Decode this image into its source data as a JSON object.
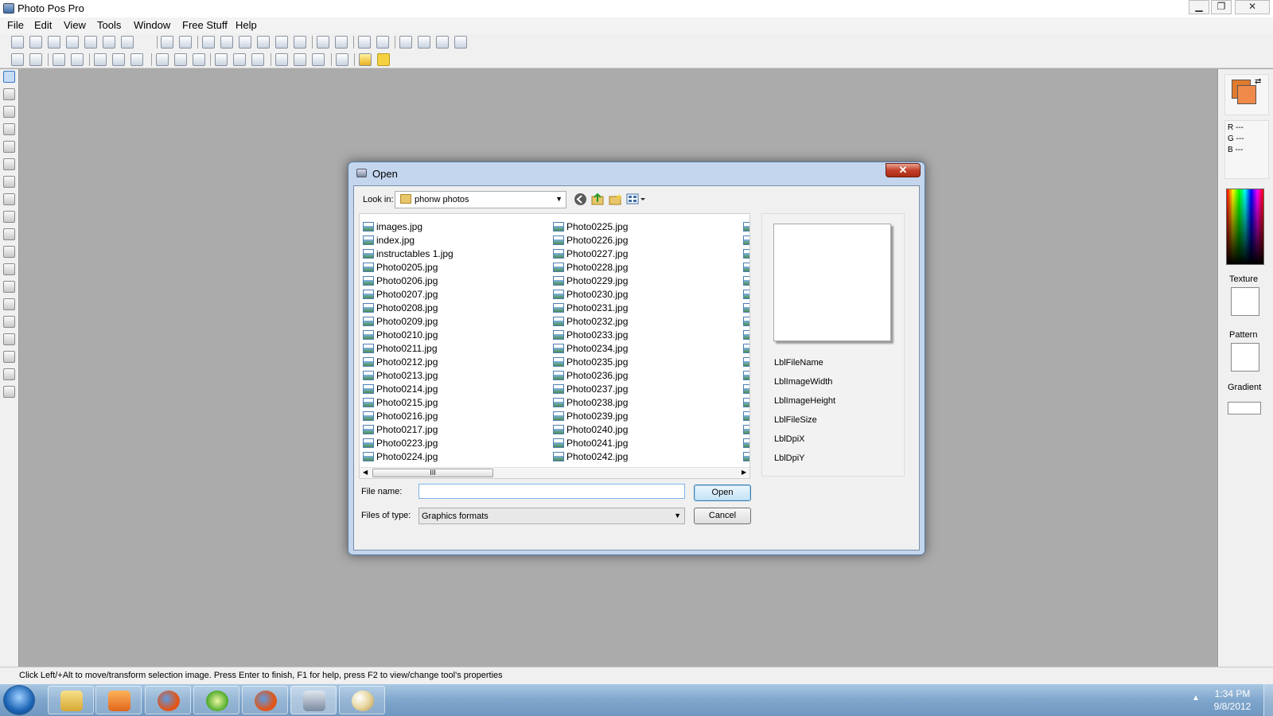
{
  "app": {
    "title": "Photo Pos Pro",
    "window_controls": {
      "minimize": "▁",
      "restore": "❐",
      "close": "✕"
    }
  },
  "menu": [
    "File",
    "Edit",
    "View",
    "Tools",
    "Window",
    "Free Stuff",
    "Help"
  ],
  "toolbar_icons": {
    "row1": [
      "new-icon",
      "open-icon",
      "browse-icon",
      "save-icon",
      "save-as-icon",
      "print-icon",
      "scan-icon",
      "undo-icon",
      "redo-icon",
      "cut-icon",
      "copy-icon",
      "paste-icon",
      "paste-new-icon",
      "paste-layer-icon",
      "screen-capture-icon",
      "page-icon",
      "batch-icon",
      "tools-icon",
      "properties-icon",
      "grid-icon",
      "resize-icon",
      "table-icon",
      "ruler-icon"
    ],
    "row2": [
      "rotate-left-icon",
      "rotate-right-icon",
      "flip-horizontal-icon",
      "flip-vertical-icon",
      "contrast-icon",
      "levels-icon",
      "curves-icon",
      "brightness-icon",
      "hue-icon",
      "color-icon",
      "image-icon",
      "layers-icon",
      "filter-icon",
      "frame-icon",
      "effects-icon",
      "texture-icon",
      "sharpen-icon",
      "magic-wand-icon",
      "favorite-star-icon"
    ]
  },
  "left_tools": [
    "move-icon",
    "zoom-icon",
    "rect-select-icon",
    "lasso-icon",
    "magic-select-icon",
    "crop-icon",
    "pencil-icon",
    "brush-icon",
    "airbrush-icon",
    "clone-icon",
    "smudge-icon",
    "fill-icon",
    "shape-icon",
    "eraser-icon",
    "text-icon",
    "letter-icon",
    "dropper-icon",
    "retouch-icon",
    "red-eye-icon"
  ],
  "right_panel": {
    "foreground_color": "#e07a2e",
    "background_color": "#f08a4a",
    "rgb": {
      "r": "R ---",
      "g": "G ---",
      "b": "B ---"
    },
    "texture_label": "Texture",
    "pattern_label": "Pattern",
    "gradient_label": "Gradient"
  },
  "dialog": {
    "title": "Open",
    "close": "✕",
    "look_in_label": "Look in:",
    "look_in_value": "phonw photos",
    "files": {
      "col1": [
        "images.jpg",
        "index.jpg",
        "instructables 1.jpg",
        "Photo0205.jpg",
        "Photo0206.jpg",
        "Photo0207.jpg",
        "Photo0208.jpg",
        "Photo0209.jpg",
        "Photo0210.jpg",
        "Photo0211.jpg",
        "Photo0212.jpg",
        "Photo0213.jpg",
        "Photo0214.jpg",
        "Photo0215.jpg",
        "Photo0216.jpg",
        "Photo0217.jpg",
        "Photo0223.jpg",
        "Photo0224.jpg"
      ],
      "col2": [
        "Photo0225.jpg",
        "Photo0226.jpg",
        "Photo0227.jpg",
        "Photo0228.jpg",
        "Photo0229.jpg",
        "Photo0230.jpg",
        "Photo0231.jpg",
        "Photo0232.jpg",
        "Photo0233.jpg",
        "Photo0234.jpg",
        "Photo0235.jpg",
        "Photo0236.jpg",
        "Photo0237.jpg",
        "Photo0238.jpg",
        "Photo0239.jpg",
        "Photo0240.jpg",
        "Photo0241.jpg",
        "Photo0242.jpg"
      ]
    },
    "scroll_thumb": "III",
    "preview_labels": {
      "file_name": "LblFileName",
      "image_width": "LblImageWidth",
      "image_height": "LblImageHeight",
      "file_size": "LblFileSize",
      "dpi_x": "LblDpiX",
      "dpi_y": "LblDpiY"
    },
    "file_name_label": "File name:",
    "file_name_value": "",
    "files_of_type_label": "Files of type:",
    "files_of_type_value": "Graphics formats",
    "open_button": "Open",
    "cancel_button": "Cancel"
  },
  "status": "Click Left/+Alt to move/transform selection image. Press Enter to finish, F1 for help, press F2 to view/change tool's properties",
  "taskbar": {
    "items": [
      "explorer-icon",
      "media-player-icon",
      "firefox-icon",
      "media-center-icon",
      "firefox-icon",
      "photo-pos-pro-icon",
      "paint-icon"
    ],
    "time": "1:34 PM",
    "date": "9/8/2012",
    "tray_arrow": "▲"
  }
}
